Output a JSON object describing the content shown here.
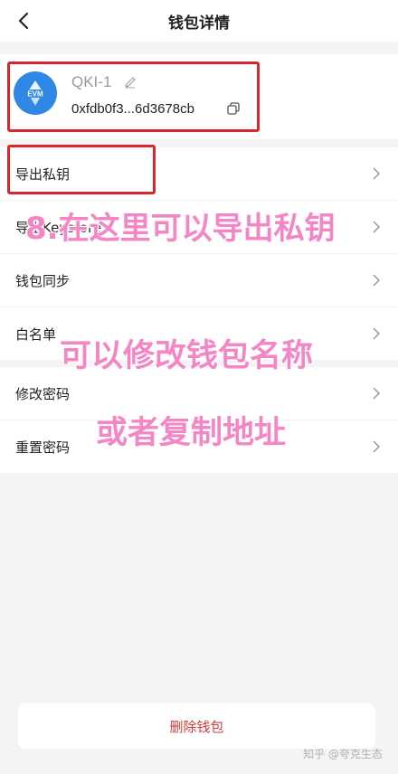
{
  "header": {
    "title": "钱包详情"
  },
  "wallet": {
    "logo_text": "EVM",
    "name": "QKI-1",
    "address": "0xfdb0f3...6d3678cb"
  },
  "menu": {
    "group1": [
      {
        "label": "导出私钥"
      },
      {
        "label": "导出Keystore"
      },
      {
        "label": "钱包同步"
      },
      {
        "label": "白名单"
      }
    ],
    "group2": [
      {
        "label": "修改密码"
      },
      {
        "label": "重置密码"
      }
    ]
  },
  "footer": {
    "delete_label": "删除钱包"
  },
  "annotations": {
    "line1": "8.在这里可以导出私钥",
    "line2": "可以修改钱包名称",
    "line3": "或者复制地址"
  },
  "watermark": "知乎 @夸克生态",
  "colors": {
    "accent_red": "#d8262b",
    "delete_red": "#d93a3a",
    "evm_blue": "#2f88e6",
    "overlay_pink": "#f486c6"
  }
}
